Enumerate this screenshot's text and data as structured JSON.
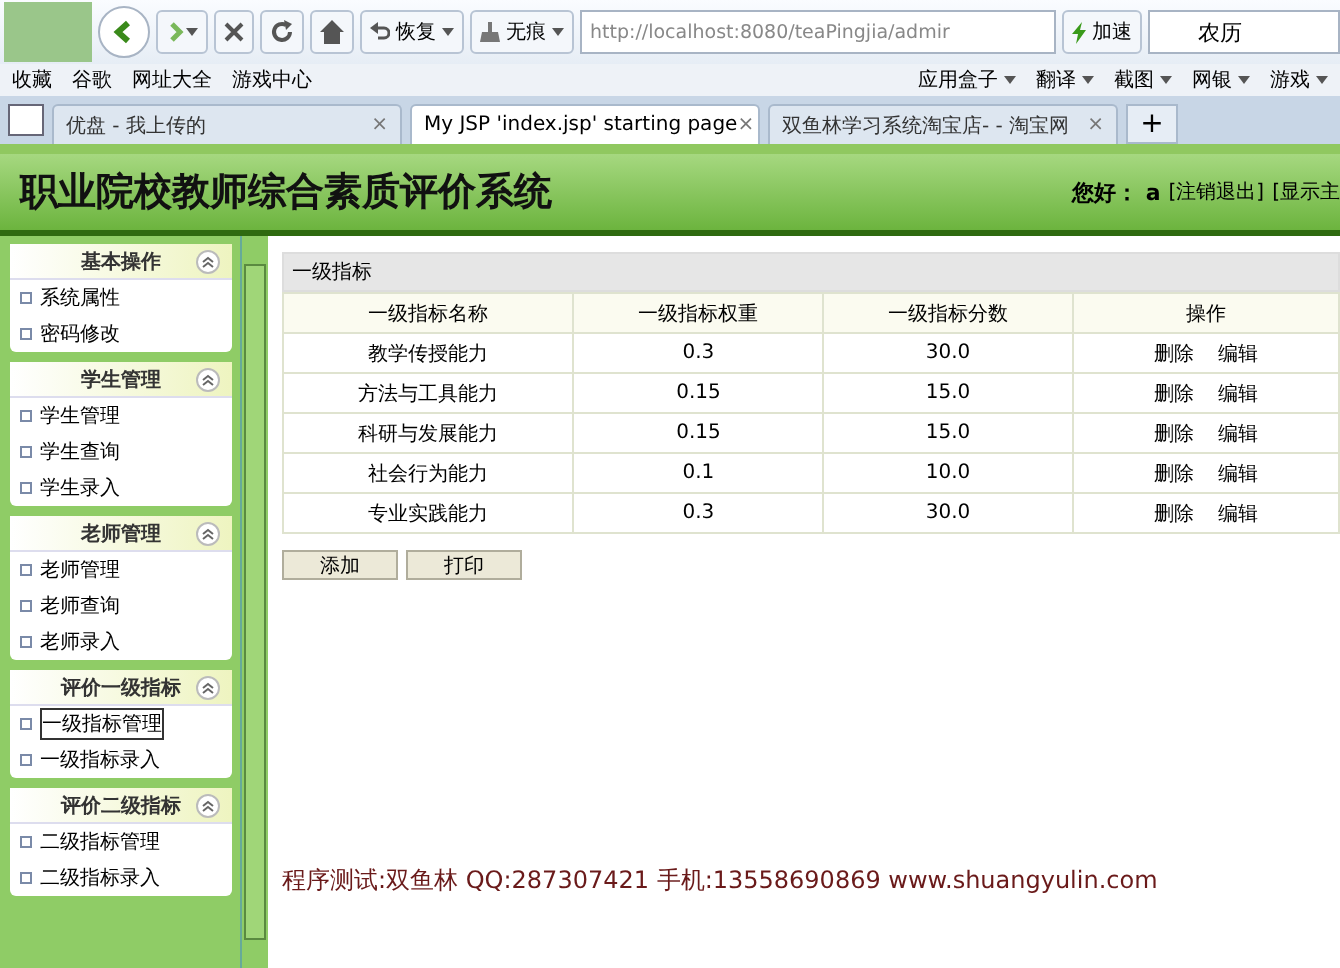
{
  "browser": {
    "toolbar": {
      "restore": "恢复",
      "incognito": "无痕",
      "address": "http://localhost:8080/teaPingjia/admir",
      "speedup": "加速",
      "search_value": "农历"
    },
    "bookmarks_left": [
      "收藏",
      "谷歌",
      "网址大全",
      "游戏中心"
    ],
    "bookmarks_right": [
      "应用盒子",
      "翻译",
      "截图",
      "网银",
      "游戏"
    ],
    "tabs": [
      {
        "label": "优盘 - 我上传的",
        "selected": false,
        "close": "×"
      },
      {
        "label": "My JSP 'index.jsp' starting page",
        "selected": true,
        "close": "×"
      },
      {
        "label": "双鱼林学习系统淘宝店- - 淘宝网",
        "selected": false,
        "close": "×"
      }
    ],
    "new_tab": "+"
  },
  "header": {
    "title": "职业院校教师综合素质评价系统",
    "greeting": "您好：",
    "user": "a",
    "links": [
      "[注销退出]",
      "[显示主"
    ]
  },
  "sidebar": [
    {
      "title": "基本操作",
      "items": [
        {
          "label": "系统属性",
          "selected": false
        },
        {
          "label": "密码修改",
          "selected": false
        }
      ]
    },
    {
      "title": "学生管理",
      "items": [
        {
          "label": "学生管理",
          "selected": false
        },
        {
          "label": "学生查询",
          "selected": false
        },
        {
          "label": "学生录入",
          "selected": false
        }
      ]
    },
    {
      "title": "老师管理",
      "items": [
        {
          "label": "老师管理",
          "selected": false
        },
        {
          "label": "老师查询",
          "selected": false
        },
        {
          "label": "老师录入",
          "selected": false
        }
      ]
    },
    {
      "title": "评价一级指标",
      "items": [
        {
          "label": "一级指标管理",
          "selected": true
        },
        {
          "label": "一级指标录入",
          "selected": false
        }
      ]
    },
    {
      "title": "评价二级指标",
      "items": [
        {
          "label": "二级指标管理",
          "selected": false
        },
        {
          "label": "二级指标录入",
          "selected": false
        }
      ]
    }
  ],
  "table": {
    "caption": "一级指标",
    "columns": [
      "一级指标名称",
      "一级指标权重",
      "一级指标分数",
      "操作"
    ],
    "rows": [
      {
        "name": "教学传授能力",
        "weight": "0.3",
        "score": "30.0",
        "actions": [
          "删除",
          "编辑"
        ]
      },
      {
        "name": "方法与工具能力",
        "weight": "0.15",
        "score": "15.0",
        "actions": [
          "删除",
          "编辑"
        ]
      },
      {
        "name": "科研与发展能力",
        "weight": "0.15",
        "score": "15.0",
        "actions": [
          "删除",
          "编辑"
        ]
      },
      {
        "name": "社会行为能力",
        "weight": "0.1",
        "score": "10.0",
        "actions": [
          "删除",
          "编辑"
        ]
      },
      {
        "name": "专业实践能力",
        "weight": "0.3",
        "score": "30.0",
        "actions": [
          "删除",
          "编辑"
        ]
      }
    ]
  },
  "buttons": [
    "添加",
    "打印"
  ],
  "footer": "程序测试:双鱼林 QQ:287307421 手机:13558690869 www.shuangyulin.com"
}
